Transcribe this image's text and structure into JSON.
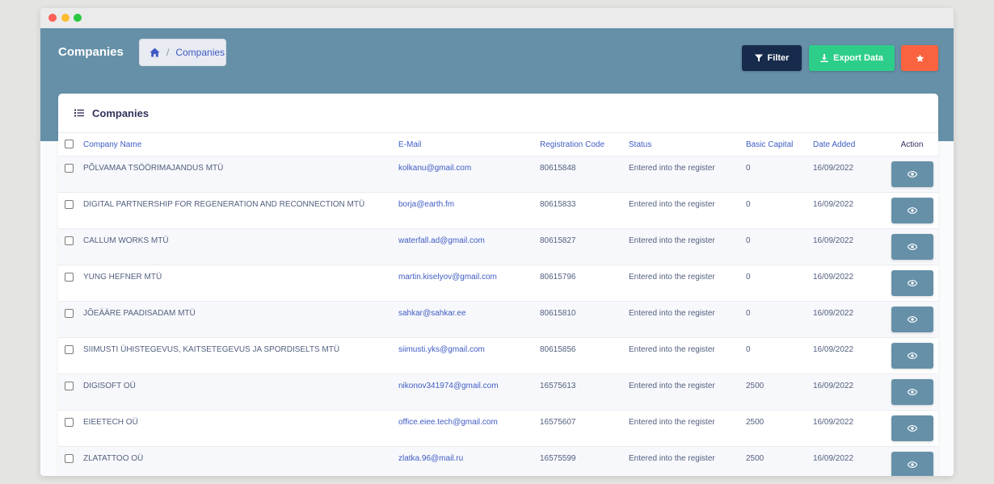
{
  "header": {
    "page_title": "Companies",
    "breadcrumb": {
      "current": "Companies"
    },
    "buttons": {
      "filter": "Filter",
      "export": "Export Data"
    }
  },
  "card": {
    "title": "Companies"
  },
  "table": {
    "columns": {
      "company_name": "Company Name",
      "email": "E-Mail",
      "registration_code": "Registration Code",
      "status": "Status",
      "basic_capital": "Basic Capital",
      "date_added": "Date Added",
      "action": "Action"
    },
    "rows": [
      {
        "name": "PÕLVAMAA TSÖÖRIMAJANDUS MTÜ",
        "email": "kolkanu@gmail.com",
        "code": "80615848",
        "status": "Entered into the register",
        "capital": "0",
        "date": "16/09/2022"
      },
      {
        "name": "DIGITAL PARTNERSHIP FOR REGENERATION AND RECONNECTION MTÜ",
        "email": "borja@earth.fm",
        "code": "80615833",
        "status": "Entered into the register",
        "capital": "0",
        "date": "16/09/2022"
      },
      {
        "name": "CALLUM WORKS MTÜ",
        "email": "waterfall.ad@gmail.com",
        "code": "80615827",
        "status": "Entered into the register",
        "capital": "0",
        "date": "16/09/2022"
      },
      {
        "name": "YUNG HEFNER MTÜ",
        "email": "martin.kiselyov@gmail.com",
        "code": "80615796",
        "status": "Entered into the register",
        "capital": "0",
        "date": "16/09/2022"
      },
      {
        "name": "JÕEÄÄRE PAADISADAM MTÜ",
        "email": "sahkar@sahkar.ee",
        "code": "80615810",
        "status": "Entered into the register",
        "capital": "0",
        "date": "16/09/2022"
      },
      {
        "name": "SIIMUSTI ÜHISTEGEVUS, KAITSETEGEVUS JA SPORDISELTS MTÜ",
        "email": "siimusti.yks@gmail.com",
        "code": "80615856",
        "status": "Entered into the register",
        "capital": "0",
        "date": "16/09/2022"
      },
      {
        "name": "DIGISOFT OÜ",
        "email": "nikonov341974@gmail.com",
        "code": "16575613",
        "status": "Entered into the register",
        "capital": "2500",
        "date": "16/09/2022"
      },
      {
        "name": "EIEETECH OÜ",
        "email": "office.eiee.tech@gmail.com",
        "code": "16575607",
        "status": "Entered into the register",
        "capital": "2500",
        "date": "16/09/2022"
      },
      {
        "name": "ZLATATTOO OÜ",
        "email": "zlatka.96@mail.ru",
        "code": "16575599",
        "status": "Entered into the register",
        "capital": "2500",
        "date": "16/09/2022"
      }
    ]
  },
  "icons": {
    "home": "home-icon",
    "filter": "filter-icon",
    "download": "download-icon",
    "star": "star-icon",
    "list": "list-icon",
    "view": "eye-icon"
  },
  "colors": {
    "banner": "#6690a8",
    "filter_button": "#172b4d",
    "export_button": "#2dce89",
    "star_button": "#fb6340",
    "link": "#3f5cc4",
    "view_button": "#6690a8"
  }
}
